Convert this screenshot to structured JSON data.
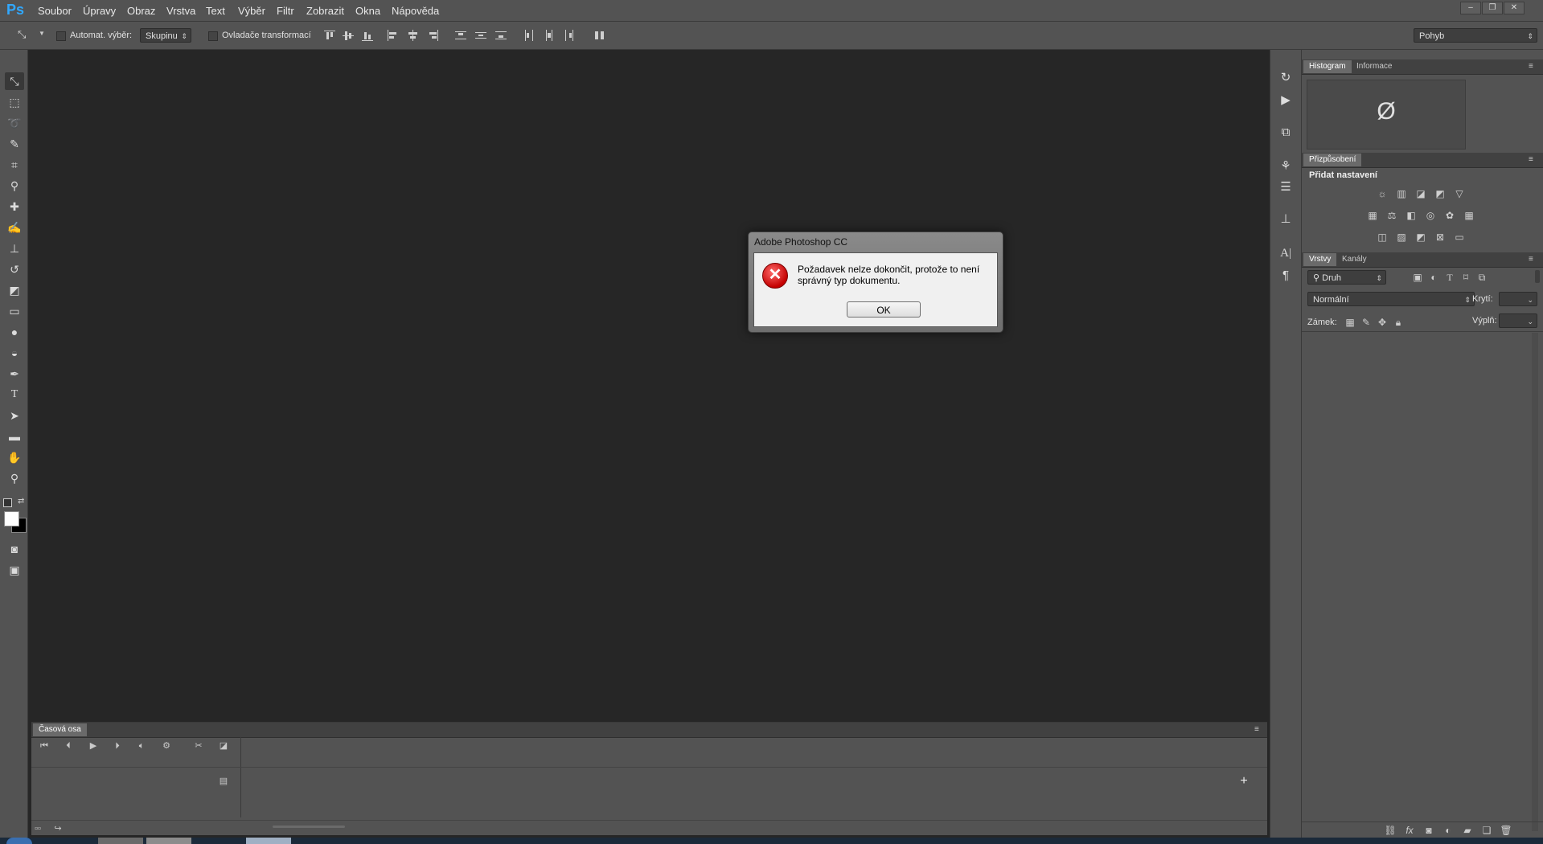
{
  "app": {
    "logo": "Ps"
  },
  "menu": [
    "Soubor",
    "Úpravy",
    "Obraz",
    "Vrstva",
    "Text",
    "Výběr",
    "Filtr",
    "Zobrazit",
    "Okna",
    "Nápověda"
  ],
  "options_bar": {
    "auto_select_label": "Automat. výběr:",
    "auto_select_value": "Skupinu",
    "transform_controls_label": "Ovladače transformací",
    "workspace_value": "Pohyb"
  },
  "timeline": {
    "tab_label": "Časová osa"
  },
  "histogram_panel": {
    "tab_histogram": "Histogram",
    "tab_info": "Informace",
    "empty_symbol": "Ø"
  },
  "adjustments_panel": {
    "tab": "Přizpůsobení",
    "heading": "Přidat nastavení"
  },
  "layers_panel": {
    "tab_layers": "Vrstvy",
    "tab_channels": "Kanály",
    "filter_kind": "Druh",
    "blend_mode": "Normální",
    "opacity_label": "Krytí:",
    "lock_label": "Zámek:",
    "fill_label": "Výplň:"
  },
  "dialog": {
    "title": "Adobe Photoshop CC",
    "message": "Požadavek nelze dokončit, protože to není správný typ dokumentu.",
    "ok_label": "OK"
  },
  "colors": {
    "canvas": "#262626",
    "panel": "#535353",
    "accent": "#31a8ff",
    "error": "#c40000"
  }
}
